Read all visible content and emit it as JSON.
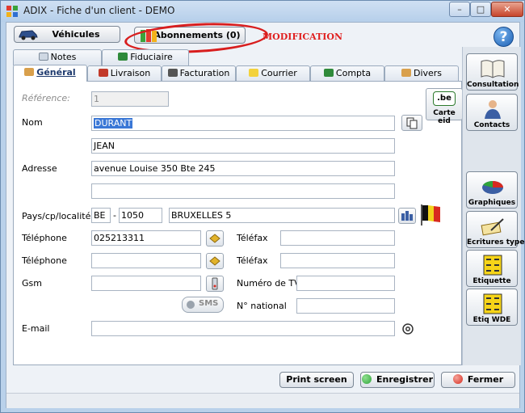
{
  "window": {
    "title": "ADIX - Fiche d'un client - DEMO",
    "min_label": "–",
    "max_label": "□",
    "close_label": "✕"
  },
  "topbar": {
    "vehicules_label": "Véhicules",
    "abonnements_label": "Abonnements (0)",
    "annotation": "MODIFICATION",
    "help_label": "?"
  },
  "tabs_row1": [
    {
      "label": "Notes",
      "icon": "notes-icon"
    },
    {
      "label": "Fiduciaire",
      "icon": "fiduciaire-icon"
    }
  ],
  "tabs_row2": [
    {
      "label": "Général",
      "icon": "general-icon",
      "active": true
    },
    {
      "label": "Livraison",
      "icon": "truck-icon"
    },
    {
      "label": "Facturation",
      "icon": "pen-icon"
    },
    {
      "label": "Courrier",
      "icon": "envelope-icon"
    },
    {
      "label": "Compta",
      "icon": "calculator-icon"
    },
    {
      "label": "Divers",
      "icon": "divers-icon"
    }
  ],
  "form": {
    "reference_label": "Référence:",
    "reference_value": "1",
    "nom_label": "Nom",
    "nom_value": "DURANT",
    "prenom_value": "JEAN",
    "adresse_label": "Adresse",
    "adresse1_value": "avenue Louise 350 Bte 245",
    "adresse2_value": "",
    "pays_label": "Pays/cp/localité",
    "pays_value": "BE",
    "cp_separator": "-",
    "cp_value": "1050",
    "localite_value": "BRUXELLES 5",
    "tel1_label": "Téléphone",
    "tel1_value": "025213311",
    "tel2_label": "Téléphone",
    "tel2_value": "",
    "telefax1_label": "Téléfax",
    "telefax1_value": "",
    "telefax2_label": "Téléfax",
    "telefax2_value": "",
    "gsm_label": "Gsm",
    "gsm_value": "",
    "tva_label": "Numéro de TVA",
    "tva_value": "",
    "sms_label": "SMS",
    "national_label": "N° national",
    "national_value": "",
    "email_label": "E-mail",
    "email_value": "",
    "carte_eid_label": "Carte eid",
    "carte_eid_logo": ".be"
  },
  "sidebar": [
    {
      "label": "Consultation",
      "icon": "book-icon"
    },
    {
      "label": "Contacts",
      "icon": "person-icon"
    },
    {
      "label": "Graphiques",
      "icon": "pie-chart-icon"
    },
    {
      "label": "Ecritures types",
      "icon": "writing-icon"
    },
    {
      "label": "Etiquette",
      "icon": "label-icon"
    },
    {
      "label": "Etiq WDE",
      "icon": "label-wde-icon"
    }
  ],
  "bottom": {
    "print_label": "Print screen",
    "save_label": "Enregistrer",
    "close_label": "Fermer"
  },
  "colors": {
    "accent": "#3a77d6",
    "annotation": "#d81e1e",
    "save_dot": "#2fa43a",
    "close_dot": "#d62a1e"
  }
}
